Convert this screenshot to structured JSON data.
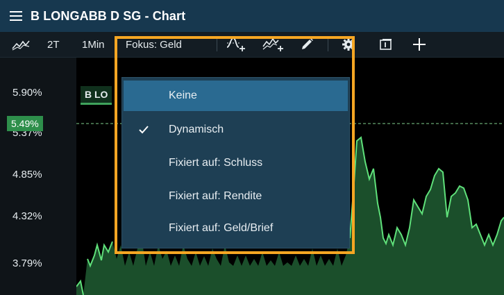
{
  "window": {
    "title": "B LONGABB D SG - Chart"
  },
  "toolbar": {
    "period_label": "2T",
    "interval_label": "1Min",
    "focus_label": "Fokus: Geld"
  },
  "y_axis": {
    "ticks": [
      "5.90%",
      "5.37%",
      "4.85%",
      "4.32%",
      "3.79%"
    ]
  },
  "price_marker": {
    "label": "5.49%"
  },
  "legend": {
    "label": "B LO"
  },
  "focus_menu": {
    "items": [
      {
        "label": "Keine",
        "highlighted": true,
        "checked": false
      },
      {
        "label": "Dynamisch",
        "highlighted": false,
        "checked": true
      },
      {
        "label": "Fixiert auf: Schluss",
        "highlighted": false,
        "checked": false
      },
      {
        "label": "Fixiert auf: Rendite",
        "highlighted": false,
        "checked": false
      },
      {
        "label": "Fixiert auf: Geld/Brief",
        "highlighted": false,
        "checked": false
      }
    ]
  },
  "colors": {
    "titlebar": "#17384f",
    "menu_bg": "#1e3f54",
    "menu_highlight": "#2a6a91",
    "focus_outline": "#f5a623",
    "series_line": "#5fe07a",
    "series_fill": "#1b4f2b",
    "price_tag": "#2e8f4b"
  }
}
